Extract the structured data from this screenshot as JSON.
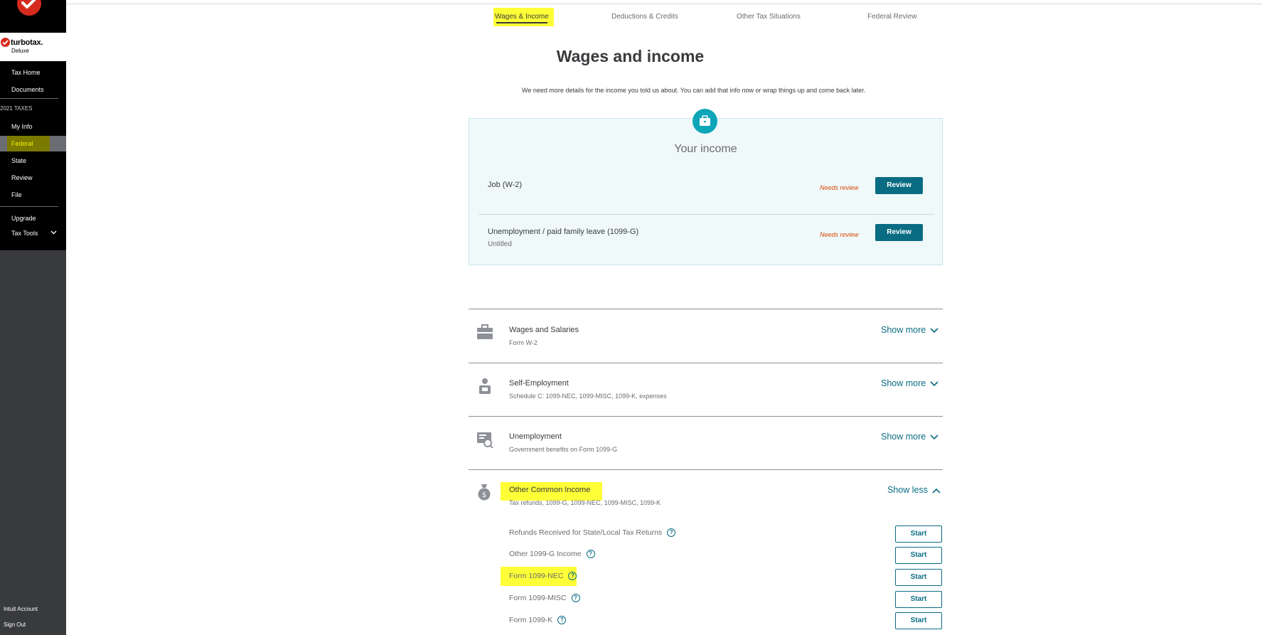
{
  "sidebar": {
    "brand": "turbotax.",
    "edition": "Deluxe",
    "nav_top": [
      "Tax Home",
      "Documents"
    ],
    "section_label": "2021 TAXES",
    "nav_taxes": [
      "My Info",
      "Federal",
      "State",
      "Review",
      "File"
    ],
    "nav_extra": [
      "Upgrade",
      "Tax Tools"
    ],
    "bottom": [
      "Intuit Account",
      "Sign Out"
    ]
  },
  "steps": [
    "Wages & Income",
    "Deductions & Credits",
    "Other Tax Situations",
    "Federal Review"
  ],
  "page": {
    "title": "Wages and income",
    "subtitle": "We need more details for the income you told us about. You can add that info now or wrap things up and come back later."
  },
  "income_card": {
    "title": "Your income",
    "items": [
      {
        "label": "Job (W-2)",
        "sub": "",
        "status": "Needs review",
        "button": "Review"
      },
      {
        "label": "Unemployment / paid family leave (1099-G)",
        "sub": "Untitled",
        "status": "Needs review",
        "button": "Review"
      }
    ]
  },
  "sections": [
    {
      "title": "Wages and Salaries",
      "desc": "Form W-2",
      "toggle": "Show more",
      "icon": "briefcase-icon"
    },
    {
      "title": "Self-Employment",
      "desc": "Schedule C: 1099-NEC, 1099-MISC, 1099-K, expenses",
      "toggle": "Show more",
      "icon": "worker-icon"
    },
    {
      "title": "Unemployment",
      "desc": "Government benefits on Form 1099-G",
      "toggle": "Show more",
      "icon": "certificate-icon"
    },
    {
      "title": "Other Common Income",
      "desc": "Tax refunds, 1099-G, 1099-NEC, 1099-MISC, 1099-K",
      "toggle": "Show less",
      "icon": "money-bag-icon"
    }
  ],
  "other_income_items": [
    {
      "label": "Refunds Received for State/Local Tax Returns",
      "button": "Start"
    },
    {
      "label": "Other 1099-G Income",
      "button": "Start"
    },
    {
      "label": "Form 1099-NEC",
      "button": "Start"
    },
    {
      "label": "Form 1099-MISC",
      "button": "Start"
    },
    {
      "label": "Form 1099-K",
      "button": "Start"
    }
  ],
  "help_glyph": "?",
  "colors": {
    "accent": "#0a6c82",
    "teal_icon": "#0ca6b8",
    "needs_review": "#d44704",
    "highlight": "#ffff37"
  }
}
